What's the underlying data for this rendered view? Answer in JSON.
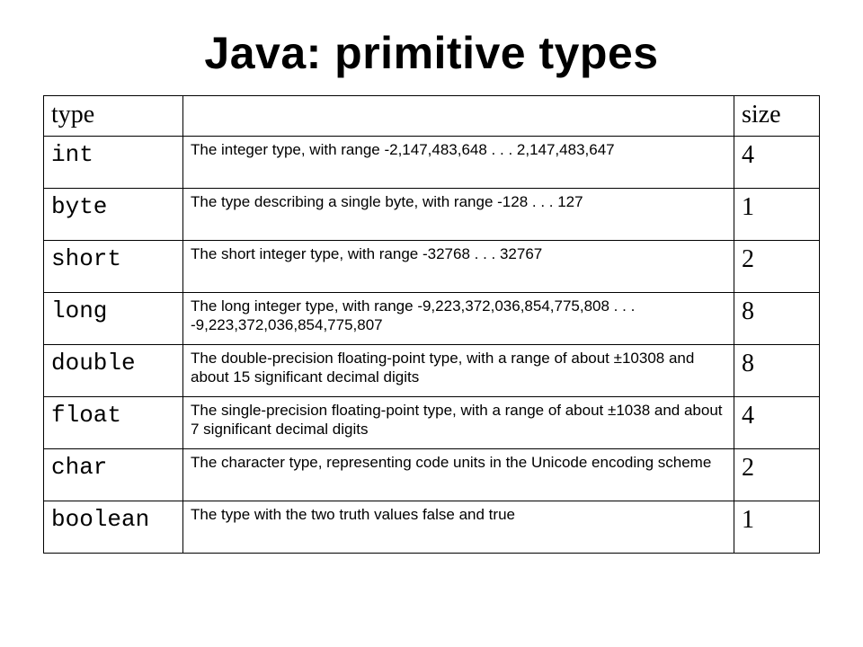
{
  "title": "Java: primitive types",
  "headers": {
    "type": "type",
    "desc": "",
    "size": "size"
  },
  "rows": [
    {
      "type": "int",
      "desc": "The integer type, with range -2,147,483,648 . . . 2,147,483,647",
      "size": "4"
    },
    {
      "type": "byte",
      "desc": "The type describing a single byte, with range -128 . . . 127",
      "size": "1"
    },
    {
      "type": "short",
      "desc": "The short integer type, with range -32768 . . . 32767",
      "size": "2"
    },
    {
      "type": "long",
      "desc": "The long integer type, with range -9,223,372,036,854,775,808 . . . -9,223,372,036,854,775,807",
      "size": "8"
    },
    {
      "type": "double",
      "desc": "The double-precision floating-point type, with a range of about ±10308 and about 15 significant decimal digits",
      "size": "8"
    },
    {
      "type": "float",
      "desc": "The single-precision floating-point type, with a range of about ±1038 and about 7 significant decimal digits",
      "size": "4"
    },
    {
      "type": "char",
      "desc": "The character type, representing code units in the Unicode encoding scheme",
      "size": "2"
    },
    {
      "type": "boolean",
      "desc": "The type with the two truth values false and true",
      "size": "1"
    }
  ]
}
